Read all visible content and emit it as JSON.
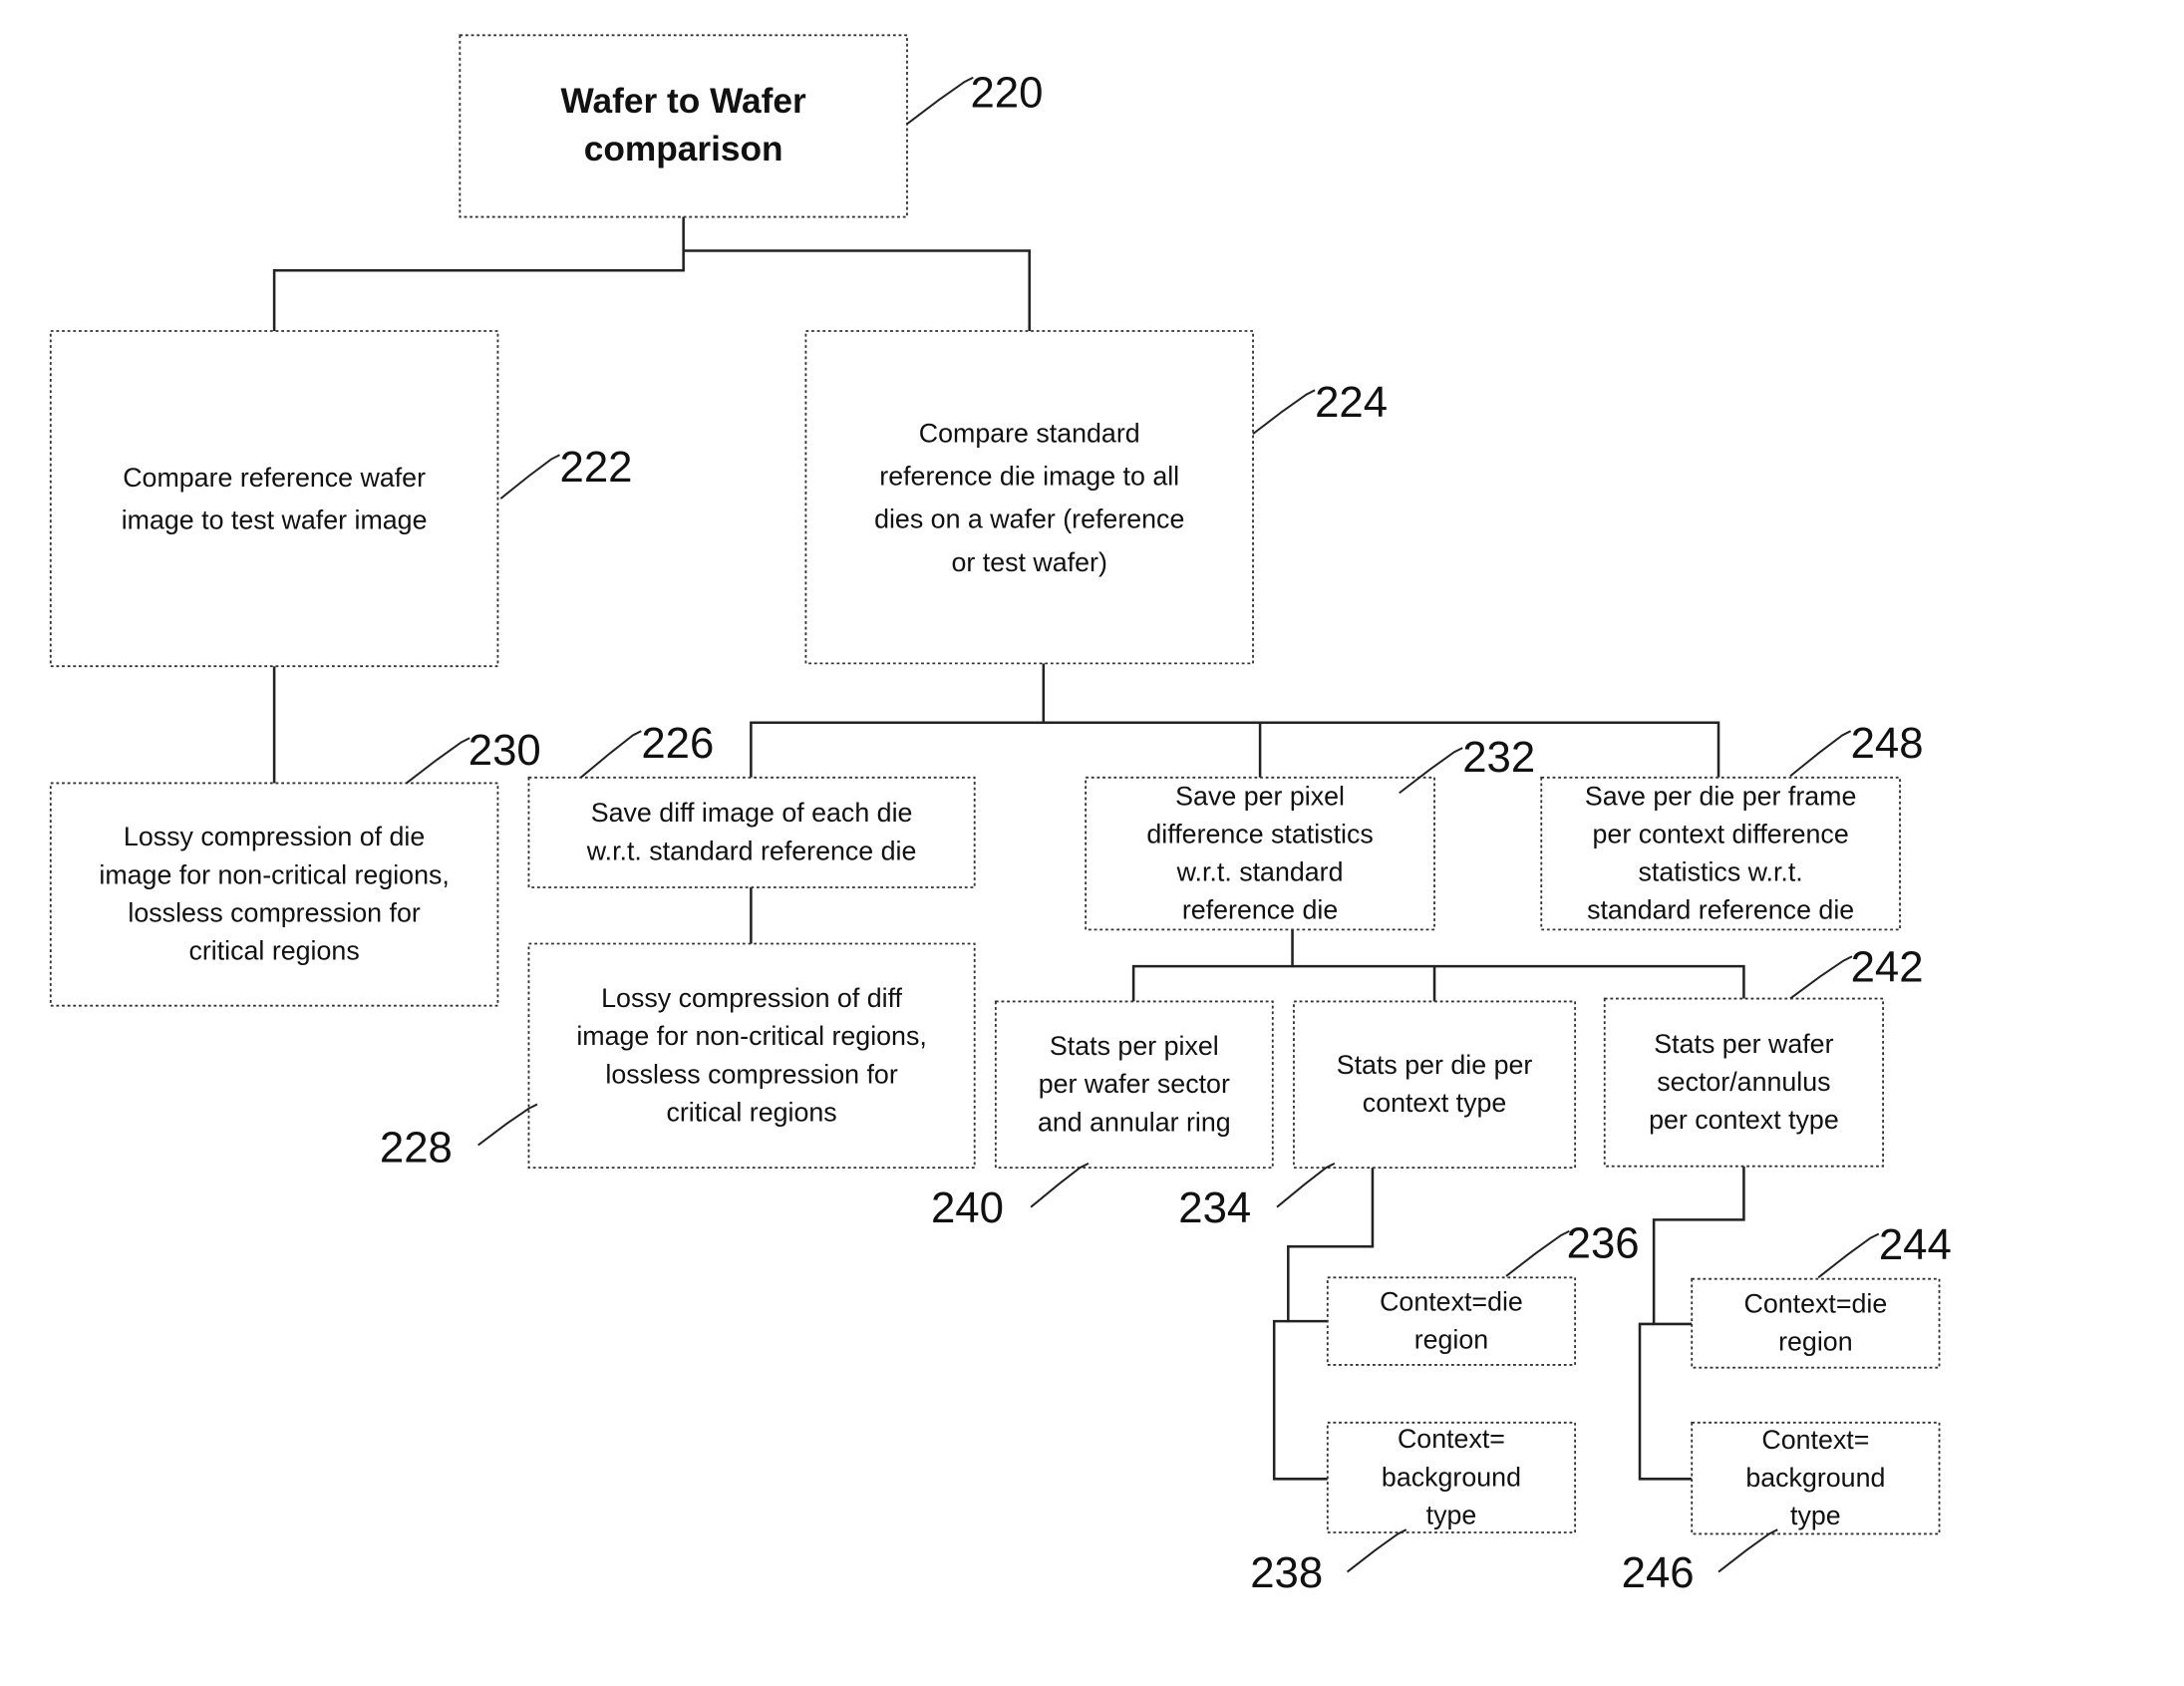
{
  "diagram": {
    "type": "flowchart-tree",
    "nodes": [
      {
        "id": "220",
        "ref": "220",
        "lines": [
          "Wafer to Wafer",
          "comparison"
        ],
        "bold": true
      },
      {
        "id": "222",
        "ref": "222",
        "lines": [
          "Compare reference wafer",
          "image to test wafer image"
        ]
      },
      {
        "id": "224",
        "ref": "224",
        "lines": [
          "Compare standard",
          "reference die image to all",
          "dies on a wafer (reference",
          "or test wafer)"
        ]
      },
      {
        "id": "230",
        "ref": "230",
        "lines": [
          "Lossy compression of die",
          "image for non-critical regions,",
          "lossless compression for",
          "critical regions"
        ]
      },
      {
        "id": "226",
        "ref": "226",
        "lines": [
          "Save diff image of each die",
          "w.r.t. standard reference die"
        ]
      },
      {
        "id": "228",
        "ref": "228",
        "lines": [
          "Lossy compression of diff",
          "image for non-critical regions,",
          "lossless compression for",
          "critical regions"
        ]
      },
      {
        "id": "232",
        "ref": "232",
        "lines": [
          "Save per pixel",
          "difference statistics",
          "w.r.t. standard",
          "reference die"
        ]
      },
      {
        "id": "248",
        "ref": "248",
        "lines": [
          "Save per die per frame",
          "per context difference",
          "statistics w.r.t.",
          "standard reference die"
        ]
      },
      {
        "id": "240",
        "ref": "240",
        "lines": [
          "Stats  per pixel",
          "per wafer sector",
          "and annular ring"
        ]
      },
      {
        "id": "234",
        "ref": "234",
        "lines": [
          "Stats per die per",
          "context type"
        ]
      },
      {
        "id": "242",
        "ref": "242",
        "lines": [
          "Stats per wafer",
          "sector/annulus",
          "per context type"
        ]
      },
      {
        "id": "236",
        "ref": "236",
        "lines": [
          "Context=die",
          "region"
        ]
      },
      {
        "id": "238",
        "ref": "238",
        "lines": [
          "Context=",
          "background",
          "type"
        ]
      },
      {
        "id": "244",
        "ref": "244",
        "lines": [
          "Context=die",
          "region"
        ]
      },
      {
        "id": "246",
        "ref": "246",
        "lines": [
          "Context=",
          "background",
          "type"
        ]
      }
    ],
    "edges": [
      [
        "220",
        "222"
      ],
      [
        "220",
        "224"
      ],
      [
        "222",
        "230"
      ],
      [
        "224",
        "226"
      ],
      [
        "224",
        "232"
      ],
      [
        "224",
        "248"
      ],
      [
        "226",
        "228"
      ],
      [
        "232",
        "240"
      ],
      [
        "232",
        "234"
      ],
      [
        "232",
        "242"
      ],
      [
        "234",
        "236"
      ],
      [
        "234",
        "238"
      ],
      [
        "242",
        "244"
      ],
      [
        "242",
        "246"
      ]
    ]
  }
}
